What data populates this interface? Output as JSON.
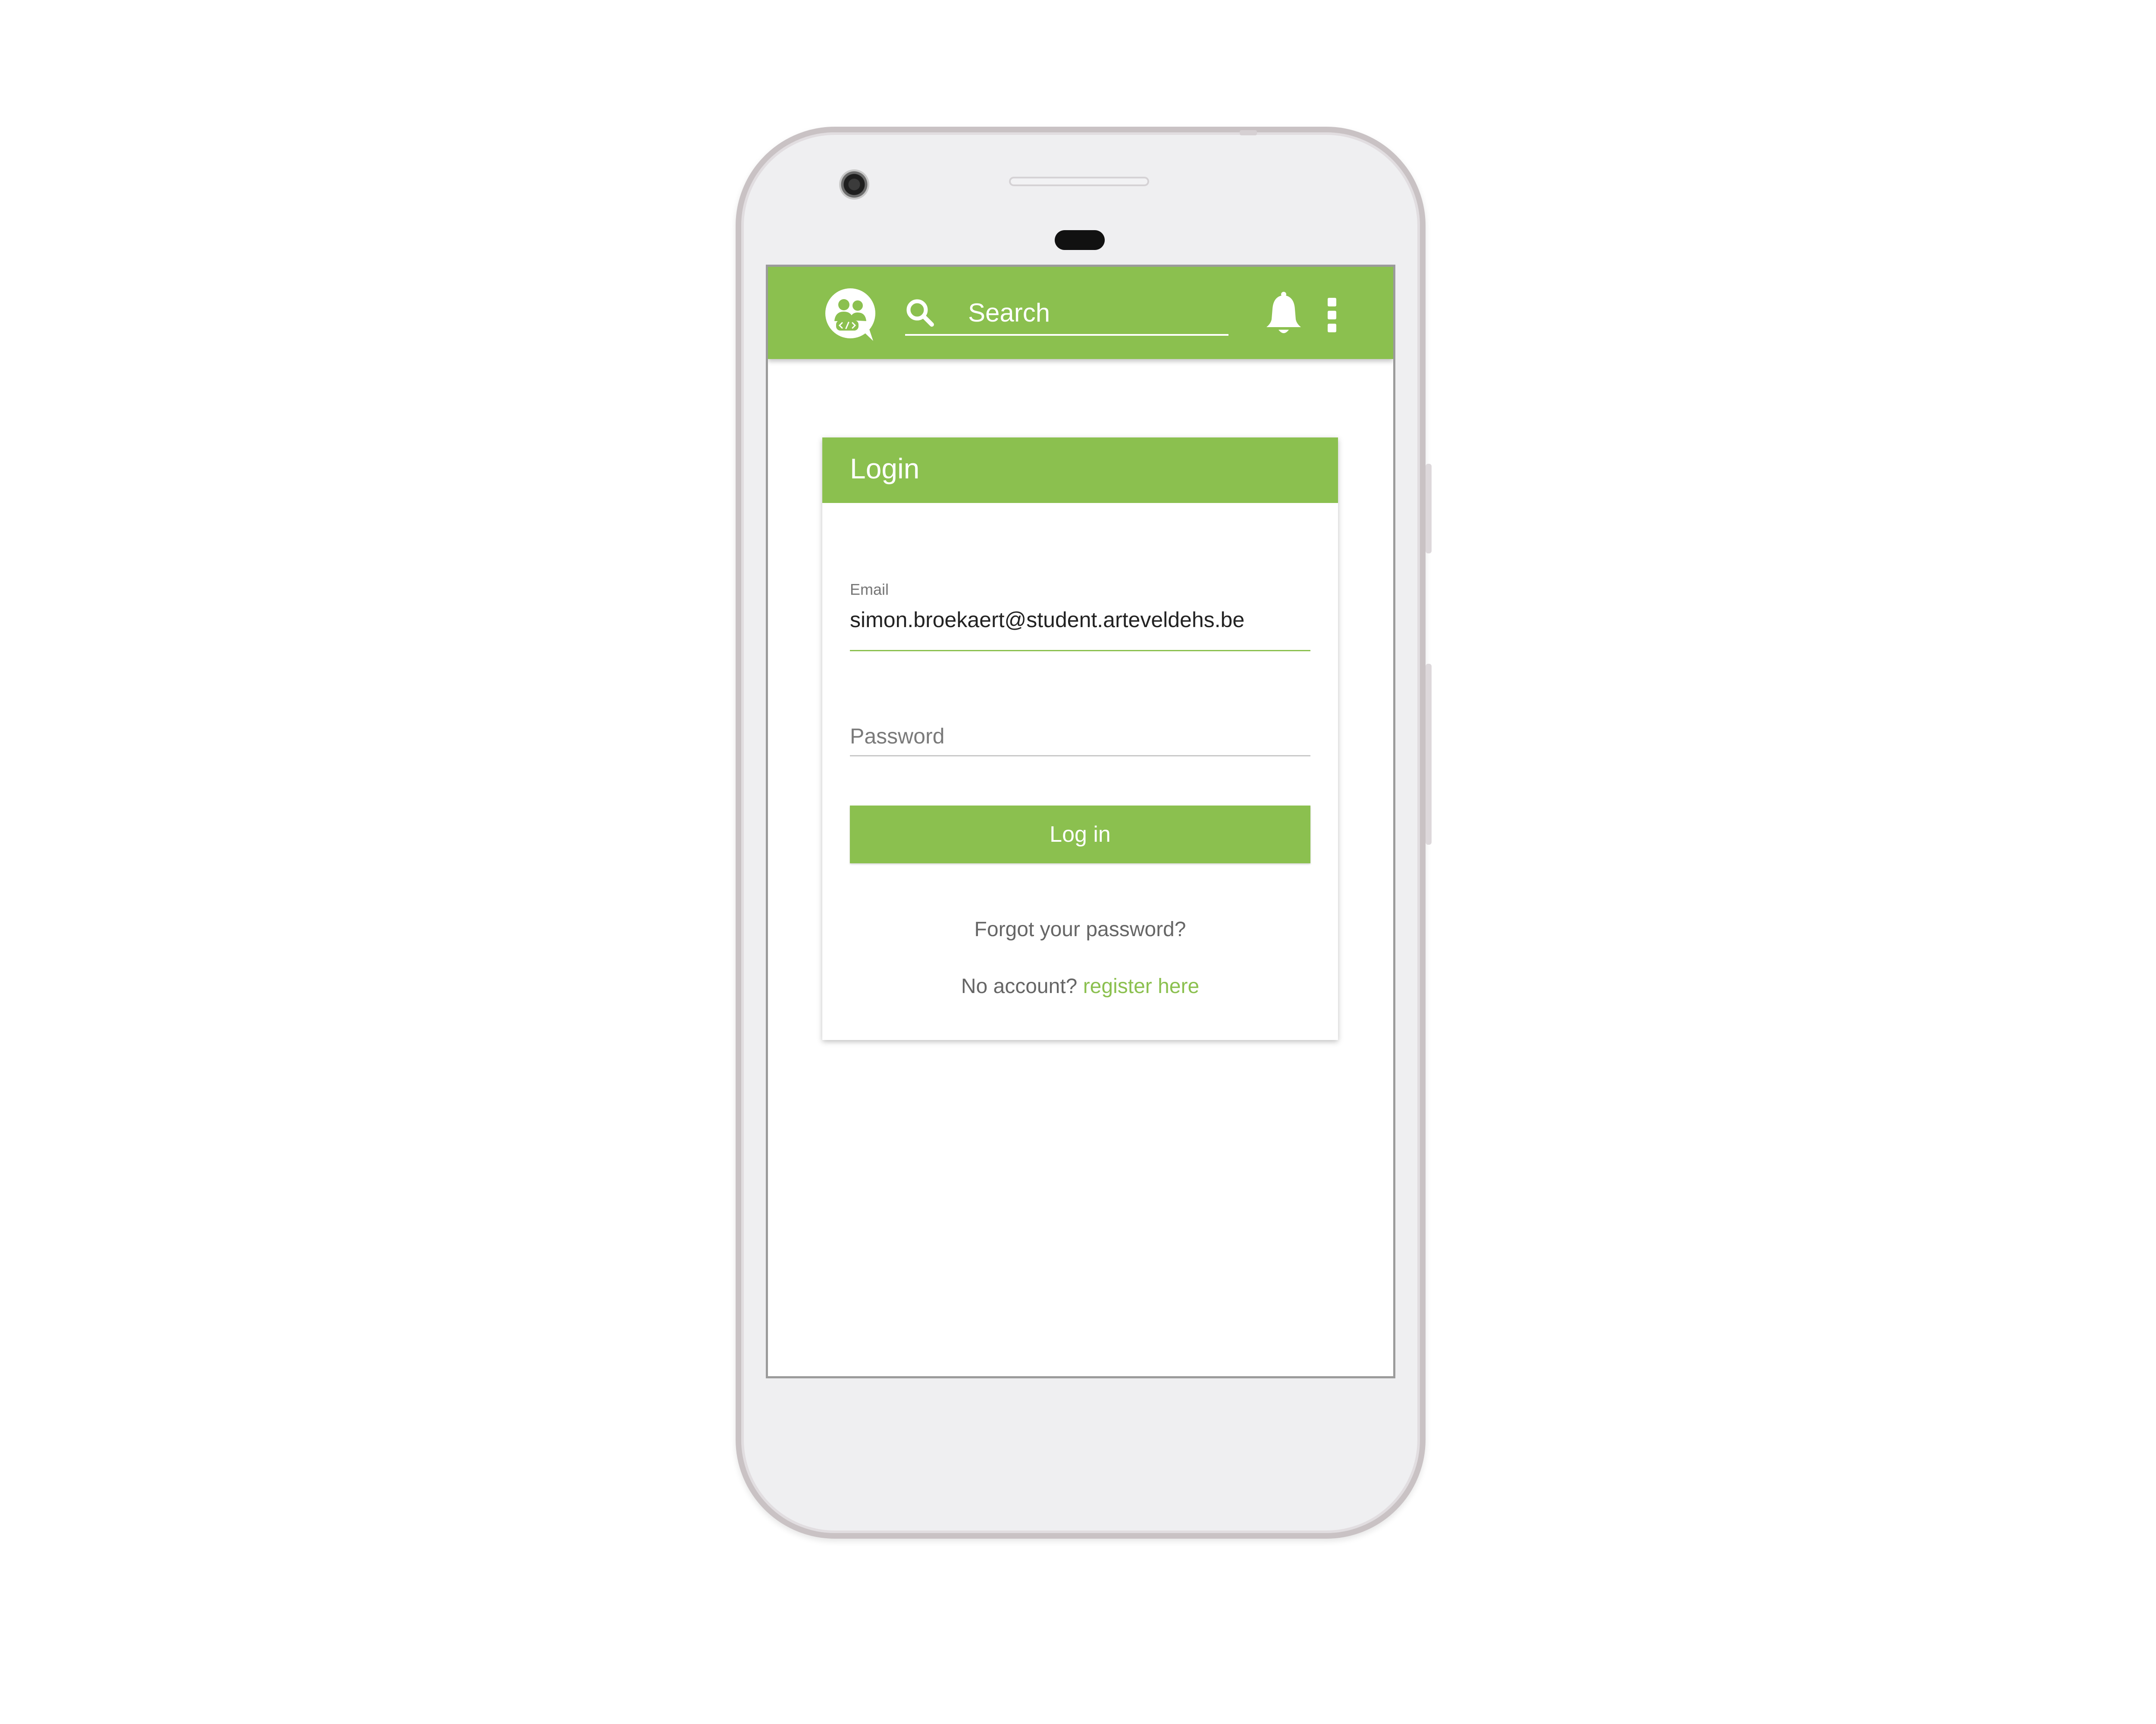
{
  "colors": {
    "accent": "#8bc04f",
    "text_muted": "#666666",
    "text_dark": "#222222"
  },
  "appbar": {
    "logo_icon": "chat-group-logo-icon",
    "search_icon": "search-icon",
    "search": {
      "placeholder": "Search",
      "value": ""
    },
    "notifications_icon": "bell-icon",
    "overflow_icon": "more-vertical-icon"
  },
  "login_card": {
    "title": "Login",
    "email": {
      "label": "Email",
      "value": "simon.broekaert@student.arteveldehs.be"
    },
    "password": {
      "placeholder": "Password",
      "value": ""
    },
    "submit_label": "Log in",
    "forgot_label": "Forgot your password?",
    "no_account_text": "No account?",
    "register_label": "register here"
  }
}
